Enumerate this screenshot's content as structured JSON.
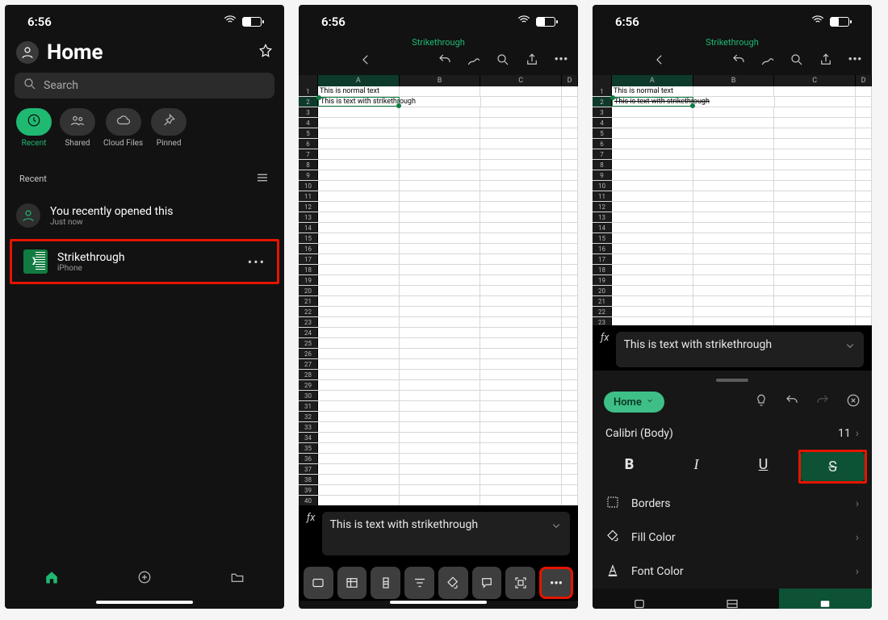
{
  "status": {
    "time": "6:56"
  },
  "phone1": {
    "title": "Home",
    "search_placeholder": "Search",
    "chips": {
      "recent": "Recent",
      "shared": "Shared",
      "cloud": "Cloud Files",
      "pinned": "Pinned"
    },
    "section": "Recent",
    "recently_opened": {
      "line1": "You recently opened this",
      "line2": "Just now"
    },
    "file": {
      "name": "Strikethrough",
      "location": "iPhone"
    }
  },
  "doc": {
    "title": "Strikethrough",
    "columns": [
      "A",
      "B",
      "C",
      "D"
    ],
    "a1_text": "This is normal text",
    "a2_text": "This is text with strikethrough",
    "fx_value": "This is text with strikethrough"
  },
  "fmt": {
    "home_label": "Home",
    "font_name": "Calibri (Body)",
    "font_size": "11",
    "bold_glyph": "B",
    "italic_glyph": "I",
    "under_glyph": "U",
    "strike_glyph": "S",
    "borders": "Borders",
    "fill": "Fill Color",
    "fontcolor": "Font Color"
  }
}
